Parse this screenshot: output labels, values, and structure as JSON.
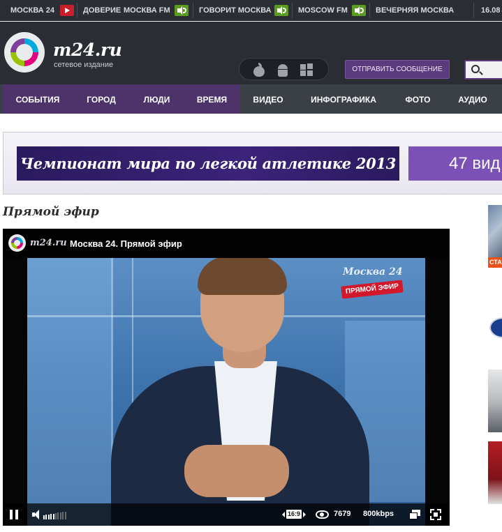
{
  "topbar": {
    "items": [
      {
        "label": "МОСКВА 24",
        "media": "video"
      },
      {
        "label": "ДОВЕРИЕ",
        "media": "none"
      },
      {
        "label": "МОСКВА FM",
        "media": "audio"
      },
      {
        "label": "ГОВОРИТ МОСКВА",
        "media": "audio"
      },
      {
        "label": "MOSCOW FM",
        "media": "audio"
      },
      {
        "label": "ВЕЧЕРНЯЯ МОСКВА",
        "media": "none"
      },
      {
        "label": "16.08",
        "media": "none"
      }
    ],
    "video_icon_color": "#c8202a",
    "audio_icon_color": "#5b9c1f"
  },
  "header": {
    "logo_text": "m24.ru",
    "logo_subtitle": "сетевое издание",
    "apps": [
      "apple-icon",
      "android-icon",
      "windows-icon"
    ],
    "send_button_label": "ОТПРАВИТЬ СООБЩЕНИЕ",
    "accent_color": "#5c3a7e"
  },
  "nav": {
    "items": [
      {
        "label": "СОБЫТИЯ",
        "highlight": true
      },
      {
        "label": "ГОРОД",
        "highlight": true
      },
      {
        "label": "ЛЮДИ",
        "highlight": true
      },
      {
        "label": "ВРЕМЯ",
        "highlight": true
      },
      {
        "label": "ВИДЕО",
        "highlight": false
      },
      {
        "label": "ИНФОГРАФИКА",
        "highlight": false
      },
      {
        "label": "ФОТО",
        "highlight": false
      },
      {
        "label": "АУДИО",
        "highlight": false
      }
    ]
  },
  "banner": {
    "title": "Чемпионат мира по легкой атлетике 2013",
    "right_text": "47 вид"
  },
  "live": {
    "section_title": "Прямой эфир",
    "player": {
      "brand": "m24.ru",
      "title": "Москва 24. Прямой эфир",
      "channel_watermark": "Москва 24",
      "live_tag": "ПРЯМОЙ ЭФИР",
      "aspect": "16:9",
      "viewers": "7679",
      "bitrate": "800kbps",
      "volume_level": 0.45,
      "playing": true
    }
  },
  "side_thumbs": {
    "first_tag": "СТА"
  }
}
